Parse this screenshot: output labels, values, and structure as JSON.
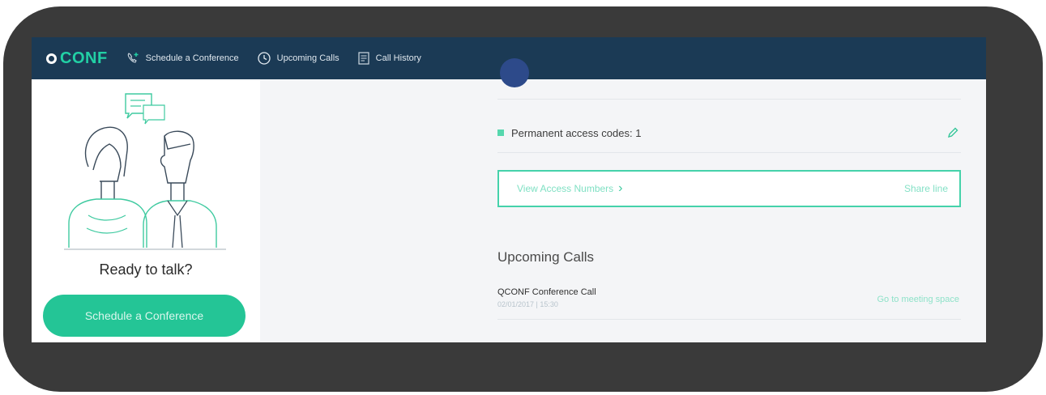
{
  "brand": {
    "name": "CONF"
  },
  "nav": {
    "schedule": "Schedule a Conference",
    "upcoming": "Upcoming Calls",
    "history": "Call History"
  },
  "sidebar": {
    "ready_text": "Ready to talk?",
    "cta_label": "Schedule a Conference",
    "illustration_icon": "people-chat-illustration"
  },
  "panel": {
    "access_codes": "Permanent access codes: 1",
    "view_access_numbers": "View Access Numbers",
    "share_line": "Share line",
    "upcoming_title": "Upcoming Calls",
    "call": {
      "name": "QCONF Conference Call",
      "datetime": "02/01/2017 | 15:30",
      "link": "Go to meeting space"
    }
  },
  "colors": {
    "nav_bg": "#1b3a55",
    "accent": "#24c596",
    "brand": "#22d0a5"
  }
}
